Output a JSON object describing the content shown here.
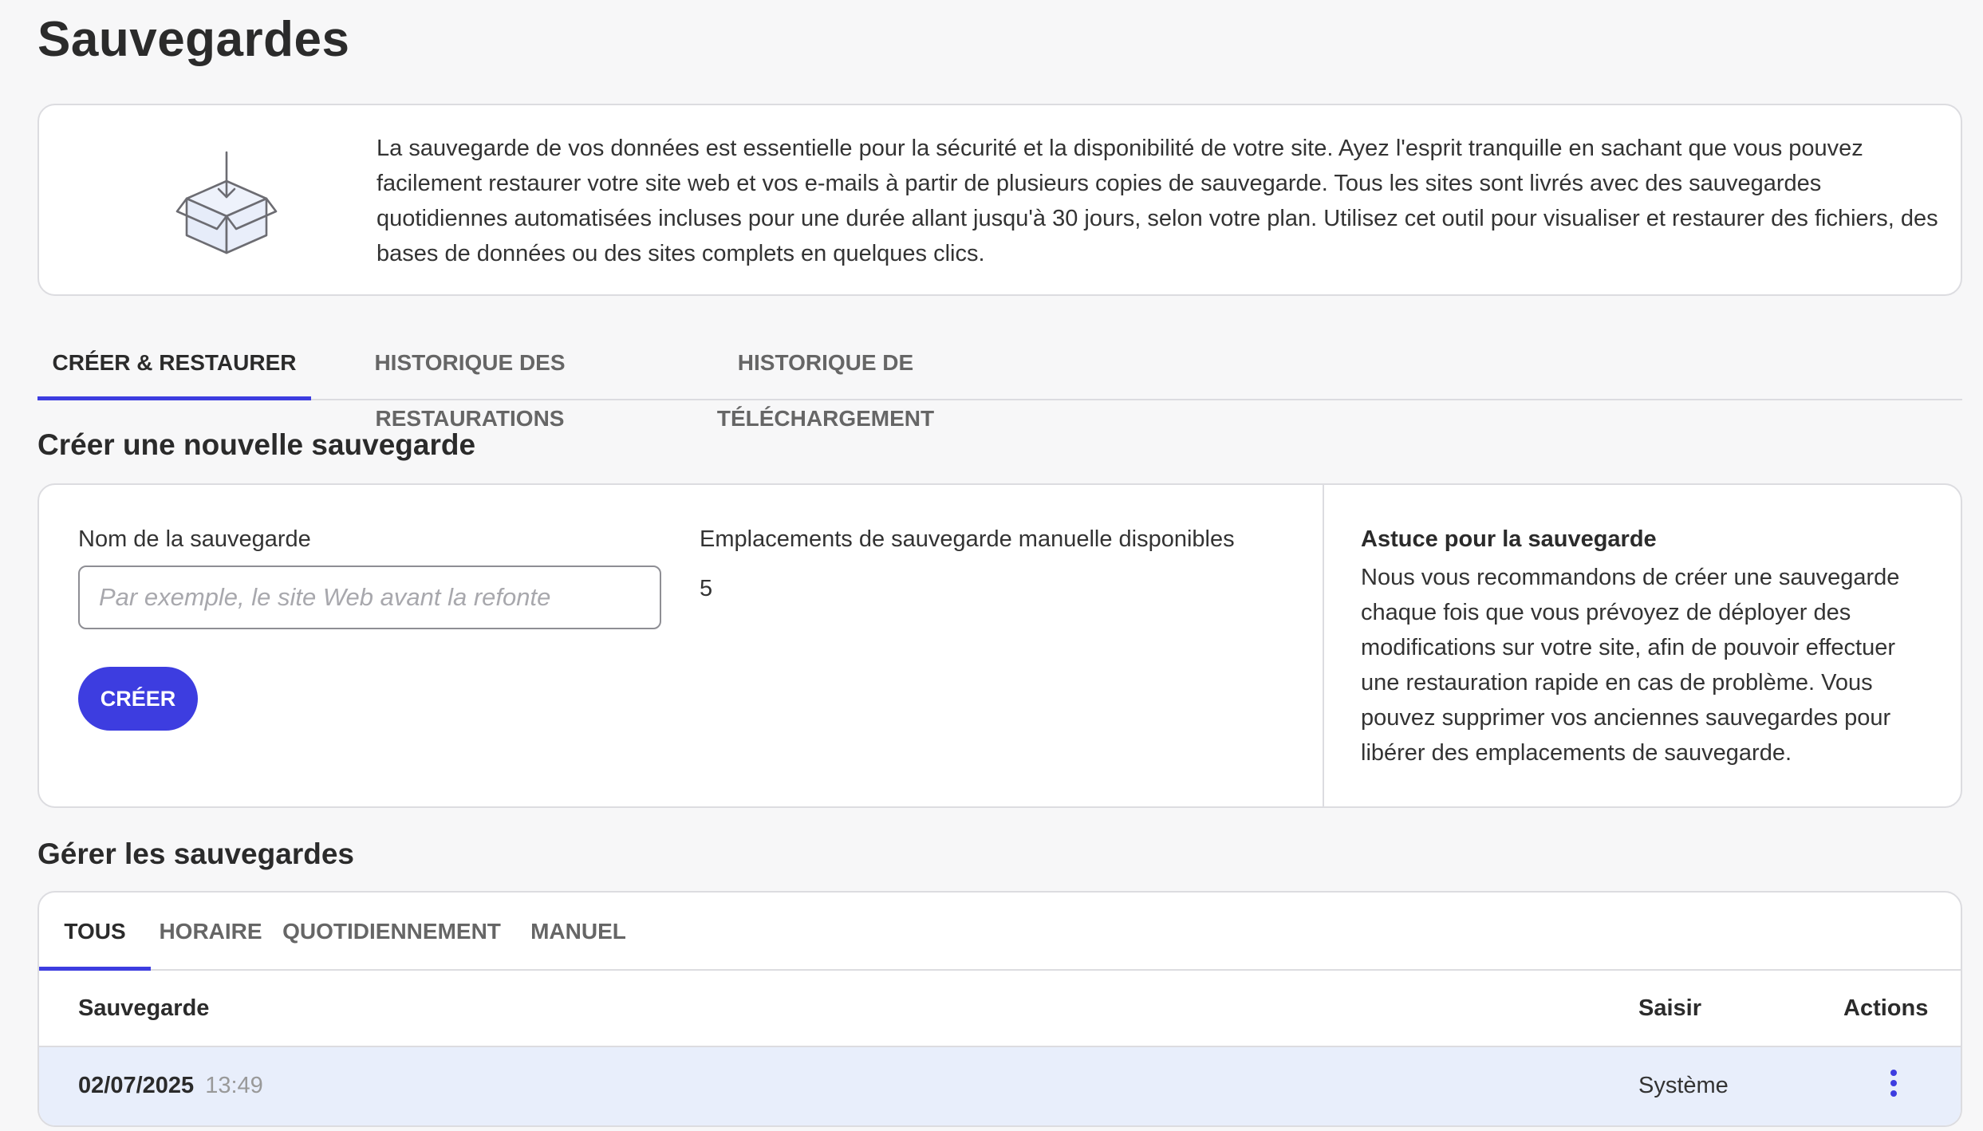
{
  "page": {
    "title": "Sauvegardes"
  },
  "intro": {
    "icon": "box-download-icon",
    "text": "La sauvegarde de vos données est essentielle pour la sécurité et la disponibilité de votre site. Ayez l'esprit tranquille en sachant que vous pouvez facilement restaurer votre site web et vos e-mails à partir de plusieurs copies de sauvegarde. Tous les sites sont livrés avec des sauvegardes quotidiennes automatisées incluses pour une durée allant jusqu'à 30 jours, selon votre plan. Utilisez cet outil pour visualiser et restaurer des fichiers, des bases de données ou des sites complets en quelques clics."
  },
  "main_tabs": [
    {
      "label": "CRÉER & RESTAURER",
      "active": true
    },
    {
      "label": "HISTORIQUE DES RESTAURATIONS",
      "active": false
    },
    {
      "label": "HISTORIQUE DE TÉLÉCHARGEMENT",
      "active": false
    }
  ],
  "create": {
    "section_title": "Créer une nouvelle sauvegarde",
    "name_label": "Nom de la sauvegarde",
    "name_placeholder": "Par exemple, le site Web avant la refonte",
    "name_value": "",
    "slots_label": "Emplacements de sauvegarde manuelle disponibles",
    "slots_value": "5",
    "button_label": "CRÉER",
    "tip_title": "Astuce pour la sauvegarde",
    "tip_text": "Nous vous recommandons de créer une sauvegarde chaque fois que vous prévoyez de déployer des modifications sur votre site, afin de pouvoir effectuer une restauration rapide en cas de problème. Vous pouvez supprimer vos anciennes sauvegardes pour libérer des emplacements de sauvegarde."
  },
  "manage": {
    "section_title": "Gérer les sauvegardes",
    "tabs": [
      {
        "label": "TOUS",
        "active": true
      },
      {
        "label": "HORAIRE",
        "active": false
      },
      {
        "label": "QUOTIDIENNEMENT",
        "active": false
      },
      {
        "label": "MANUEL",
        "active": false
      }
    ],
    "columns": {
      "backup": "Sauvegarde",
      "type": "Saisir",
      "actions": "Actions"
    },
    "rows": [
      {
        "date": "02/07/2025",
        "time": "13:49",
        "type": "Système",
        "actions_icon": "kebab-menu-icon"
      }
    ]
  },
  "colors": {
    "accent": "#3d3de0",
    "row_highlight": "#e8eefb",
    "border": "#dcdce0"
  }
}
